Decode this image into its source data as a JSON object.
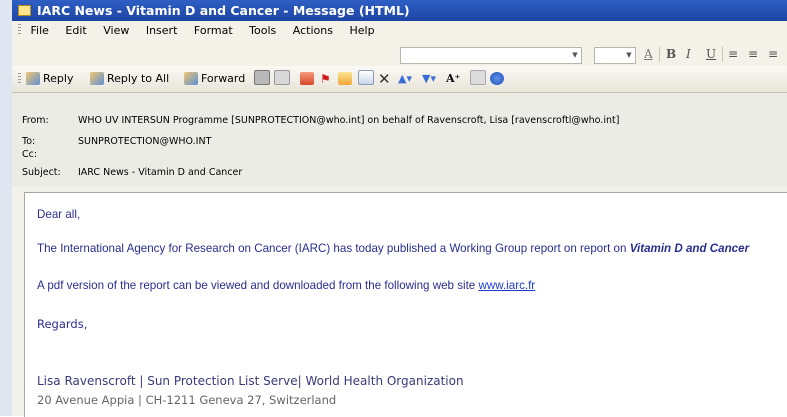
{
  "window": {
    "title": "IARC News - Vitamin D and Cancer - Message (HTML)"
  },
  "menu": [
    "File",
    "Edit",
    "View",
    "Insert",
    "Format",
    "Tools",
    "Actions",
    "Help"
  ],
  "toolbar": {
    "reply": "Reply",
    "reply_all": "Reply to All",
    "forward": "Forward"
  },
  "format_bar": {
    "font_value": "",
    "size_value": "",
    "bold": "B",
    "italic": "I",
    "underline": "U"
  },
  "header": {
    "from_label": "From:",
    "from_value": "WHO UV INTERSUN Programme [SUNPROTECTION@who.int] on behalf of Ravenscroft, Lisa [ravenscroftl@who.int]",
    "to_label": "To:",
    "to_value": "SUNPROTECTION@WHO.INT",
    "cc_label": "Cc:",
    "cc_value": "",
    "subject_label": "Subject:",
    "subject_value": "IARC News - Vitamin D and Cancer"
  },
  "message": {
    "greeting": "Dear all,",
    "p1_text": "The International Agency for Research on Cancer (IARC) has today published a Working Group report on report on ",
    "p1_emph": "Vitamin D and Cancer",
    "p2_text": "A pdf version of the report can be viewed and downloaded from the following web site ",
    "p2_link": "www.iarc.fr",
    "closing": "Regards,",
    "signature": "Lisa Ravenscroft | Sun Protection List Serve| World Health Organization",
    "address": "20 Avenue Appia | CH-1211 Geneva 27, Switzerland"
  },
  "colors": {
    "title_bar": "#1d44a3",
    "body_text": "#2a2e8f",
    "link": "#1b3bd0"
  }
}
